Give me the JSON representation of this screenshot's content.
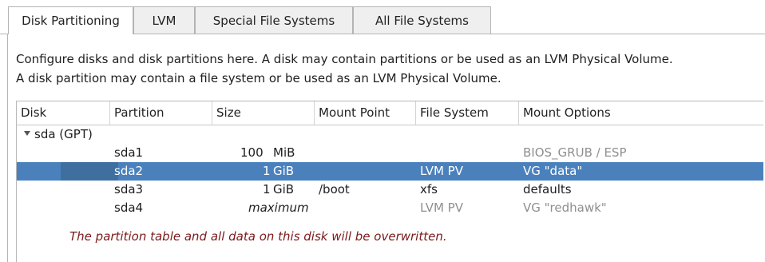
{
  "tabs": [
    {
      "label": "Disk Partitioning",
      "active": true
    },
    {
      "label": "LVM",
      "active": false
    },
    {
      "label": "Special File Systems",
      "active": false
    },
    {
      "label": "All File Systems",
      "active": false
    }
  ],
  "description": {
    "line1": "Configure disks and disk partitions here.  A disk may contain partitions or be used as an LVM Physical Volume.",
    "line2": "A disk partition may contain a file system or be used as an LVM Physical Volume."
  },
  "table": {
    "columns": [
      "Disk",
      "Partition",
      "Size",
      "Mount Point",
      "File System",
      "Mount Options"
    ],
    "disk": {
      "label": "sda (GPT)",
      "expanded": true
    },
    "rows": [
      {
        "partition": "sda1",
        "size_num": "100",
        "size_unit": "MiB",
        "mount": "",
        "fs": "",
        "options": "BIOS_GRUB / ESP",
        "selected": false,
        "fs_muted": true,
        "opt_muted": true
      },
      {
        "partition": "sda2",
        "size_num": "1",
        "size_unit": "GiB",
        "mount": "",
        "fs": "LVM PV",
        "options": "VG \"data\"",
        "selected": true,
        "fs_muted": false,
        "opt_muted": false
      },
      {
        "partition": "sda3",
        "size_num": "1",
        "size_unit": "GiB",
        "mount": "/boot",
        "fs": "xfs",
        "options": "defaults",
        "selected": false,
        "fs_muted": false,
        "opt_muted": false
      },
      {
        "partition": "sda4",
        "size_text": "maximum",
        "mount": "",
        "fs": "LVM PV",
        "options": "VG \"redhawk\"",
        "selected": false,
        "fs_muted": true,
        "opt_muted": true
      }
    ],
    "warning": "The partition table and all data on this disk will be overwritten."
  },
  "colors": {
    "selection": "#4a81bd",
    "warning": "#7a1a1a",
    "muted": "#8f8f8f"
  }
}
